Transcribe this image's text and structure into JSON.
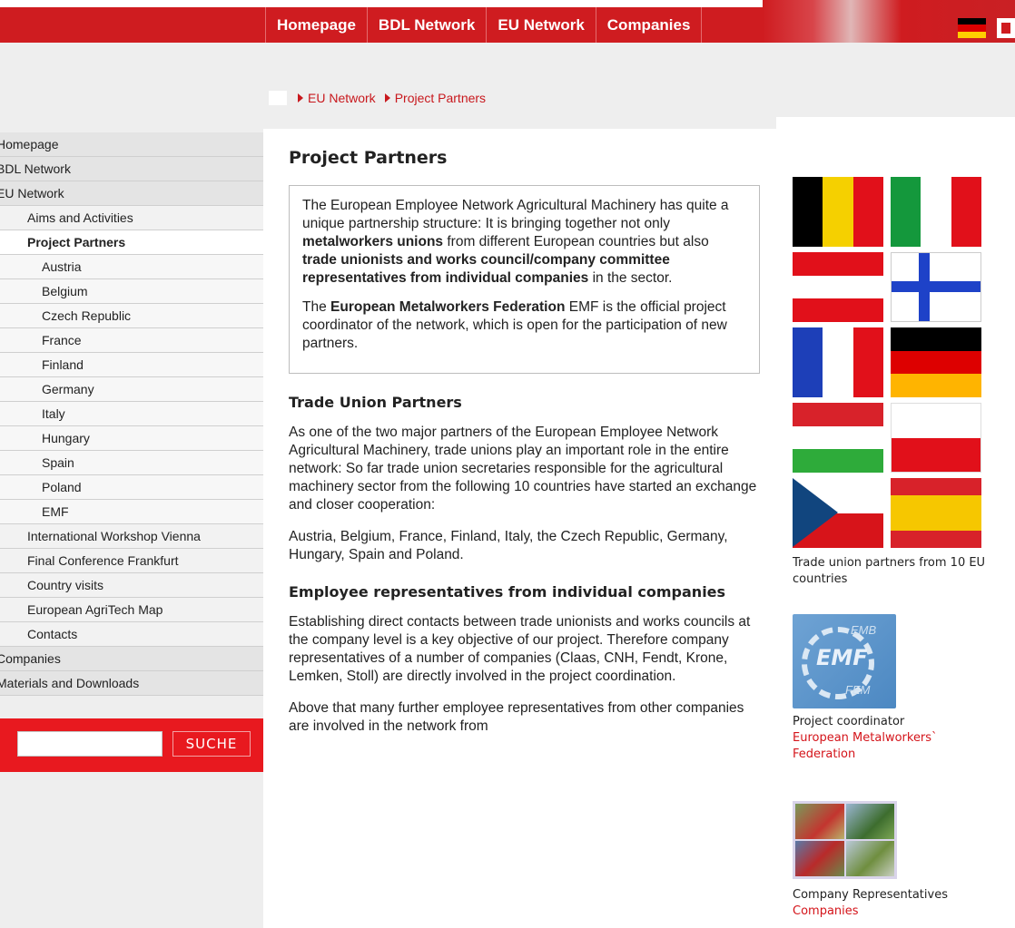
{
  "nav": {
    "items": [
      "Homepage",
      "BDL Network",
      "EU Network",
      "Companies"
    ]
  },
  "header_icons": {
    "language": "german-flag-icon",
    "print": "print-icon"
  },
  "colors": {
    "brand_red": "#cf1c20",
    "link_red": "#d4141a",
    "sidebar_grey": "#eeeeee"
  },
  "breadcrumb": [
    "EU Network",
    "Project Partners"
  ],
  "sidebar": {
    "items": [
      {
        "label": "Homepage",
        "level": 0
      },
      {
        "label": "BDL Network",
        "level": 0
      },
      {
        "label": "EU Network",
        "level": 0
      },
      {
        "label": "Aims and Activities",
        "level": 1
      },
      {
        "label": "Project Partners",
        "level": 1,
        "active": true
      },
      {
        "label": "Austria",
        "level": 2
      },
      {
        "label": "Belgium",
        "level": 2
      },
      {
        "label": "Czech Republic",
        "level": 2
      },
      {
        "label": "France",
        "level": 2
      },
      {
        "label": "Finland",
        "level": 2
      },
      {
        "label": "Germany",
        "level": 2
      },
      {
        "label": "Italy",
        "level": 2
      },
      {
        "label": "Hungary",
        "level": 2
      },
      {
        "label": "Spain",
        "level": 2
      },
      {
        "label": "Poland",
        "level": 2
      },
      {
        "label": "EMF",
        "level": 2
      },
      {
        "label": "International Workshop Vienna",
        "level": 1
      },
      {
        "label": "Final Conference Frankfurt",
        "level": 1
      },
      {
        "label": "Country visits",
        "level": 1
      },
      {
        "label": "European AgriTech Map",
        "level": 1
      },
      {
        "label": "Contacts",
        "level": 1
      },
      {
        "label": "Companies",
        "level": 0
      },
      {
        "label": "Materials and Downloads",
        "level": 0
      }
    ]
  },
  "search": {
    "value": "",
    "button": "SUCHE"
  },
  "main": {
    "title": "Project Partners",
    "intro_p1": [
      {
        "t": "The European Employee Network Agricultural Machinery has quite a unique partnership structure: It is bringing together not only ",
        "b": false
      },
      {
        "t": "metalworkers unions",
        "b": true
      },
      {
        "t": " from different European countries but also ",
        "b": false
      },
      {
        "t": "trade unionists and works council/company committee representatives from individual companies",
        "b": true
      },
      {
        "t": " in the sector.",
        "b": false
      }
    ],
    "intro_p2": [
      {
        "t": "The ",
        "b": false
      },
      {
        "t": "European Metalworkers Federation",
        "b": true
      },
      {
        "t": " EMF is the official project coordinator of the network, which is open for the participation of new partners.",
        "b": false
      }
    ],
    "h_trade": "Trade Union Partners",
    "p_trade1": "As one of the two major partners of the European Employee Network Agricultural Machinery, trade unions play an important role in the entire network: So far trade union secretaries responsible for the agricultural machinery sector from the following 10 countries have started an exchange and closer cooperation:",
    "p_trade2": "Austria, Belgium, France, Finland, Italy, the Czech Republic, Germany, Hungary, Spain and Poland.",
    "h_emp": "Employee representatives from individual companies",
    "p_emp1": "Establishing direct contacts between trade unionists and works councils at the company level is a key objective of our project. Therefore company representatives of a number of companies (Claas, CNH, Fendt, Krone, Lemken, Stoll) are directly involved in the project coordination.",
    "p_emp2": "Above that many further employee representatives from other companies are involved in the network from"
  },
  "right": {
    "flags": [
      "belgium-flag-icon",
      "italy-flag-icon",
      "austria-flag-icon",
      "finland-flag-icon",
      "france-flag-icon",
      "germany-flag-icon",
      "hungary-flag-icon",
      "poland-flag-icon",
      "czech-flag-icon",
      "spain-flag-icon"
    ],
    "caption1": "Trade union partners from 10 EU countries",
    "emf_logo_text": {
      "top": "EMB",
      "middle": "EMF",
      "bottom": "FEM"
    },
    "caption2_label": "Project coordinator",
    "caption2_link": "European Metalworkers` Federation",
    "caption3_label": "Company Representatives",
    "caption3_link": "Companies"
  }
}
